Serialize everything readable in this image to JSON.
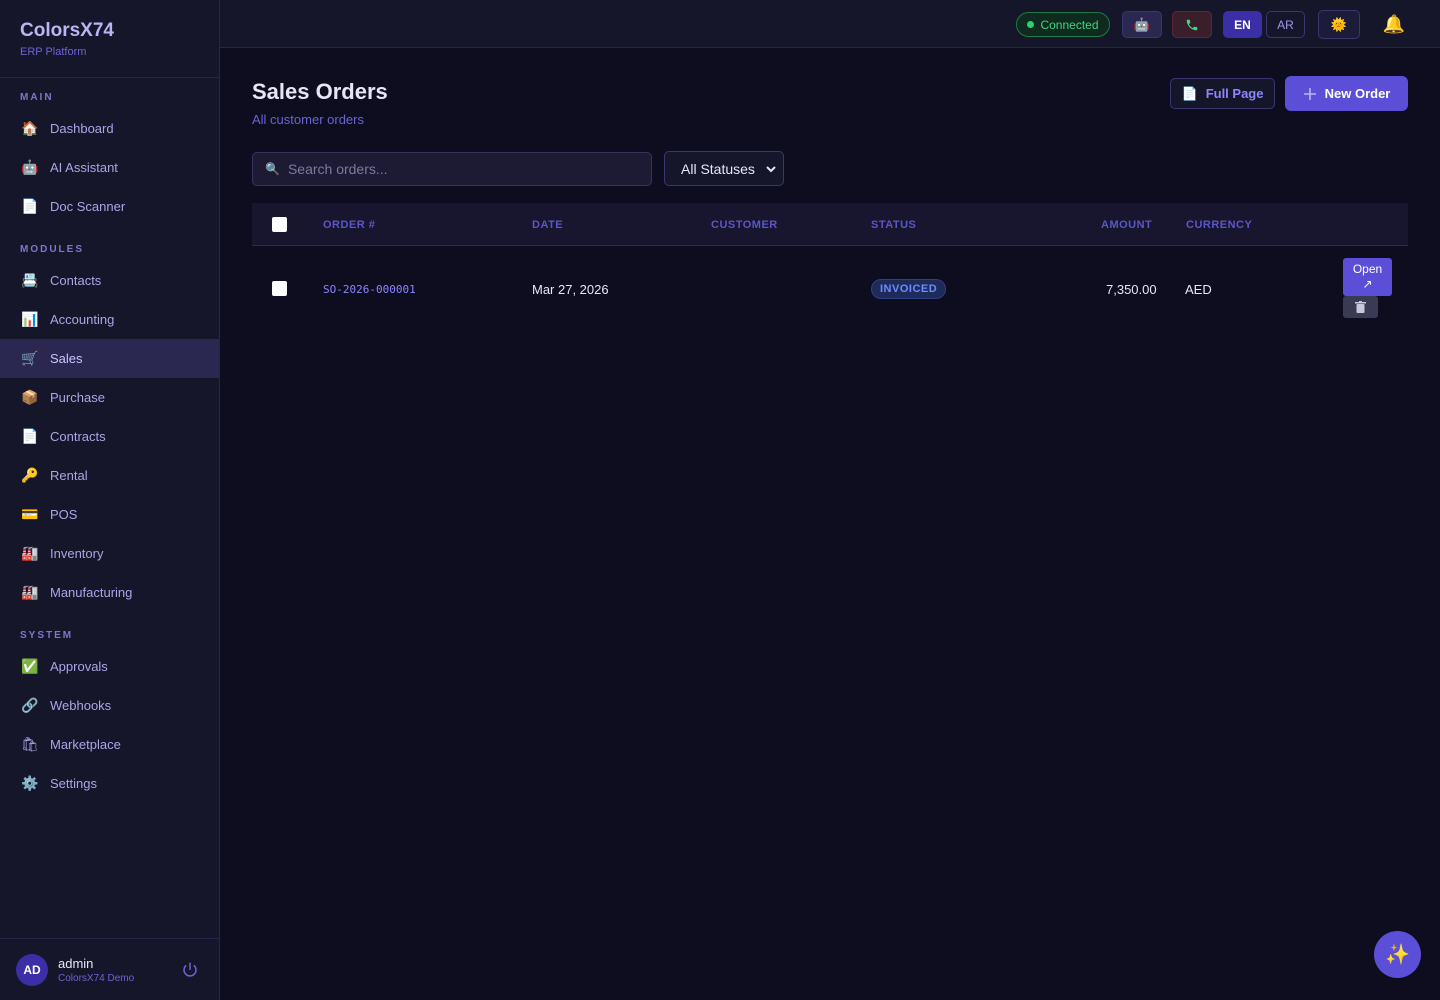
{
  "brand": {
    "title": "ColorsX74",
    "subtitle": "ERP Platform"
  },
  "sidebar": {
    "sections": [
      {
        "label": "MAIN",
        "items": [
          {
            "label": "Dashboard",
            "icon": "house-icon"
          },
          {
            "label": "AI Assistant",
            "icon": "robot-icon"
          },
          {
            "label": "Doc Scanner",
            "icon": "document-icon"
          }
        ]
      },
      {
        "label": "MODULES",
        "items": [
          {
            "label": "Contacts",
            "icon": "contacts-icon"
          },
          {
            "label": "Accounting",
            "icon": "bar-chart-icon"
          },
          {
            "label": "Sales",
            "icon": "cart-icon",
            "active": true
          },
          {
            "label": "Purchase",
            "icon": "package-icon"
          },
          {
            "label": "Contracts",
            "icon": "document-icon"
          },
          {
            "label": "Rental",
            "icon": "key-icon"
          },
          {
            "label": "POS",
            "icon": "card-icon"
          },
          {
            "label": "Inventory",
            "icon": "factory-icon"
          },
          {
            "label": "Manufacturing",
            "icon": "factory-icon"
          }
        ]
      },
      {
        "label": "SYSTEM",
        "items": [
          {
            "label": "Approvals",
            "icon": "check-icon"
          },
          {
            "label": "Webhooks",
            "icon": "link-icon"
          },
          {
            "label": "Marketplace",
            "icon": "shop-icon"
          },
          {
            "label": "Settings",
            "icon": "gear-icon"
          }
        ]
      }
    ]
  },
  "user": {
    "initials": "AD",
    "name": "admin",
    "org": "ColorsX74 Demo"
  },
  "topbar": {
    "connection": "Connected",
    "lang_en": "EN",
    "lang_ar": "AR"
  },
  "page": {
    "title": "Sales Orders",
    "subtitle": "All customer orders",
    "full_page_label": "Full Page",
    "new_order_label": "New Order"
  },
  "search": {
    "placeholder": "Search orders..."
  },
  "filter": {
    "selected": "All Statuses"
  },
  "table": {
    "columns": [
      "ORDER #",
      "DATE",
      "CUSTOMER",
      "STATUS",
      "AMOUNT",
      "CURRENCY"
    ],
    "rows": [
      {
        "order": "SO-2026-000001",
        "date": "Mar 27, 2026",
        "customer": "",
        "status": "INVOICED",
        "amount": "7,350.00",
        "currency": "AED"
      }
    ],
    "open_label": "Open",
    "open_arrow": "↗"
  },
  "colors": {
    "accent": "#5a4fd6",
    "connected": "#3fd67e",
    "status_invoiced": "#6b8cff"
  }
}
